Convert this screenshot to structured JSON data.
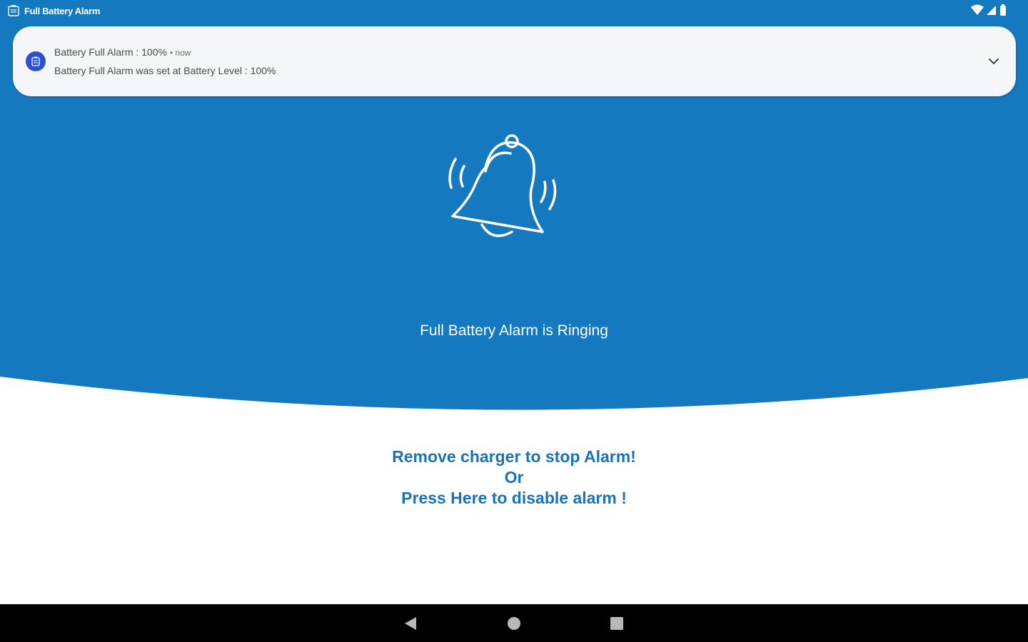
{
  "colors": {
    "brand": "#1579bf",
    "instruction_text": "#1a72b9",
    "background": "#ffffff",
    "nav_bar": "#000000",
    "notification_bg": "#f5f6fa",
    "notification_icon": "#2a4fd0"
  },
  "status_bar": {
    "app_name": "Full Battery Alarm",
    "app_icon": "battery-alarm-icon",
    "icons": [
      "wifi-icon",
      "cellular-signal-icon",
      "battery-icon"
    ]
  },
  "notification": {
    "icon": "app-notification-icon",
    "title": "Battery Full Alarm : 100%",
    "time": "now",
    "body": "Battery Full Alarm was set at Battery Level : 100%",
    "expand_icon": "chevron-down-icon"
  },
  "main": {
    "bell_icon": "ringing-bell-icon",
    "status_text": "Full Battery Alarm is Ringing",
    "instructions": {
      "line1": "Remove charger to stop Alarm!",
      "line2": "Or",
      "line3": "Press Here to disable alarm !"
    }
  },
  "nav_bar": {
    "buttons": [
      "back-icon",
      "home-icon",
      "recents-icon"
    ]
  }
}
